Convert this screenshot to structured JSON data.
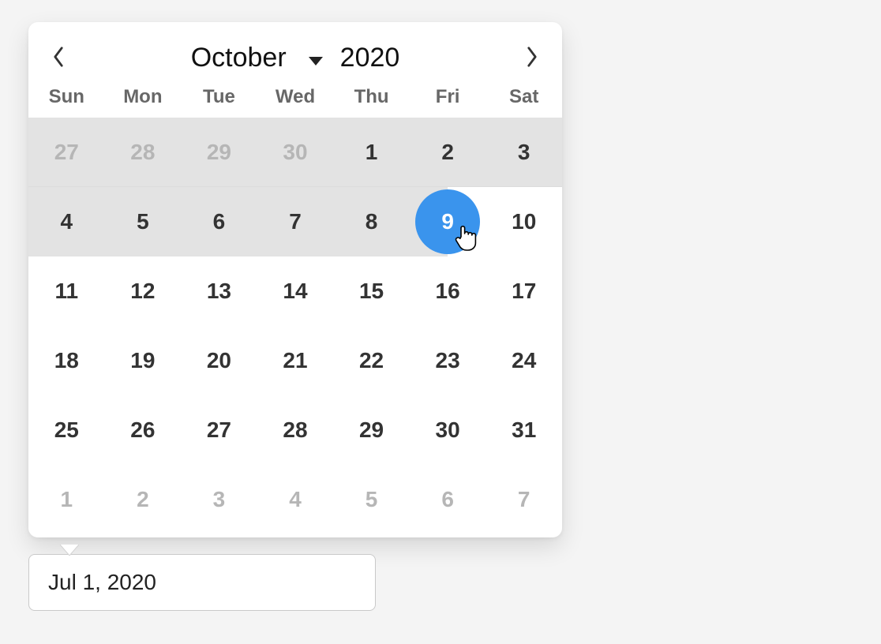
{
  "calendar": {
    "month_label": "October",
    "year_label": "2020",
    "weekdays": [
      "Sun",
      "Mon",
      "Tue",
      "Wed",
      "Thu",
      "Fri",
      "Sat"
    ],
    "days": [
      {
        "n": "27",
        "outside": true,
        "row": 0
      },
      {
        "n": "28",
        "outside": true,
        "row": 0
      },
      {
        "n": "29",
        "outside": true,
        "row": 0
      },
      {
        "n": "30",
        "outside": true,
        "row": 0
      },
      {
        "n": "1",
        "outside": false,
        "row": 0
      },
      {
        "n": "2",
        "outside": false,
        "row": 0
      },
      {
        "n": "3",
        "outside": false,
        "row": 0
      },
      {
        "n": "4",
        "outside": false,
        "row": 1
      },
      {
        "n": "5",
        "outside": false,
        "row": 1
      },
      {
        "n": "6",
        "outside": false,
        "row": 1
      },
      {
        "n": "7",
        "outside": false,
        "row": 1
      },
      {
        "n": "8",
        "outside": false,
        "row": 1
      },
      {
        "n": "9",
        "outside": false,
        "row": 1,
        "selected": true
      },
      {
        "n": "10",
        "outside": false,
        "row": 1
      },
      {
        "n": "11",
        "outside": false,
        "row": 2
      },
      {
        "n": "12",
        "outside": false,
        "row": 2
      },
      {
        "n": "13",
        "outside": false,
        "row": 2
      },
      {
        "n": "14",
        "outside": false,
        "row": 2
      },
      {
        "n": "15",
        "outside": false,
        "row": 2
      },
      {
        "n": "16",
        "outside": false,
        "row": 2
      },
      {
        "n": "17",
        "outside": false,
        "row": 2
      },
      {
        "n": "18",
        "outside": false,
        "row": 3
      },
      {
        "n": "19",
        "outside": false,
        "row": 3
      },
      {
        "n": "20",
        "outside": false,
        "row": 3
      },
      {
        "n": "21",
        "outside": false,
        "row": 3
      },
      {
        "n": "22",
        "outside": false,
        "row": 3
      },
      {
        "n": "23",
        "outside": false,
        "row": 3
      },
      {
        "n": "24",
        "outside": false,
        "row": 3
      },
      {
        "n": "25",
        "outside": false,
        "row": 4
      },
      {
        "n": "26",
        "outside": false,
        "row": 4
      },
      {
        "n": "27",
        "outside": false,
        "row": 4
      },
      {
        "n": "28",
        "outside": false,
        "row": 4
      },
      {
        "n": "29",
        "outside": false,
        "row": 4
      },
      {
        "n": "30",
        "outside": false,
        "row": 4
      },
      {
        "n": "31",
        "outside": false,
        "row": 4
      },
      {
        "n": "1",
        "outside": true,
        "row": 5
      },
      {
        "n": "2",
        "outside": true,
        "row": 5
      },
      {
        "n": "3",
        "outside": true,
        "row": 5
      },
      {
        "n": "4",
        "outside": true,
        "row": 5
      },
      {
        "n": "5",
        "outside": true,
        "row": 5
      },
      {
        "n": "6",
        "outside": true,
        "row": 5
      },
      {
        "n": "7",
        "outside": true,
        "row": 5
      }
    ]
  },
  "input": {
    "value": "Jul 1, 2020"
  },
  "colors": {
    "accent": "#3a94ed",
    "range_bg": "#e3e3e3"
  }
}
